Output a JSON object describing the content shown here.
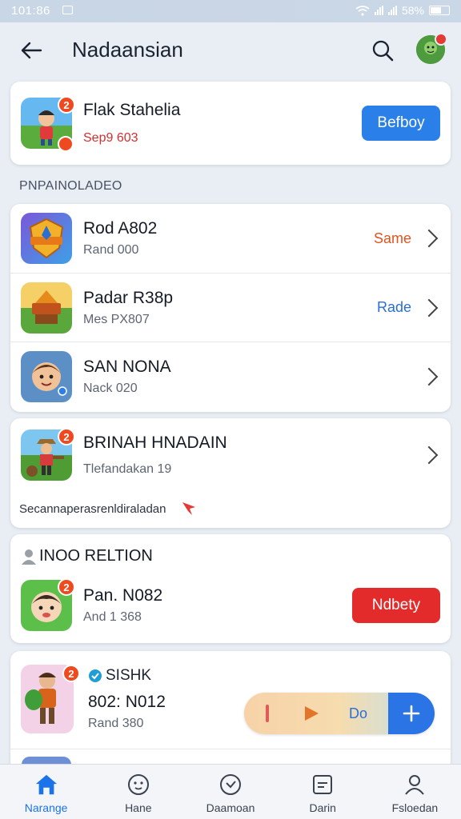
{
  "status_bar": {
    "time": "101:86",
    "battery_text": "58%"
  },
  "app_bar": {
    "title": "Nadaansian"
  },
  "featured": {
    "name": "Flak Stahelia",
    "sub": "Sep9 603",
    "badge": "2",
    "button_label": "Befboy",
    "button_color": "#2b7fe9"
  },
  "section_1": {
    "label": "PNPAINOLADEO"
  },
  "list": [
    {
      "name": "Rod A802",
      "sub": "Rand 000",
      "status": "Same",
      "status_color": "#e0531f"
    },
    {
      "name": "Padar R38p",
      "sub": "Mes PX807",
      "status": "Rade",
      "status_color": "#2a6fd6"
    },
    {
      "name": "SAN NONA",
      "sub": "Nack 020",
      "status": ""
    }
  ],
  "promo_card": {
    "name": "BRINAH HNADAIN",
    "sub": "Tlefandakan 19",
    "badge": "2",
    "note": "Secannaperasrenldiraladan"
  },
  "section_2": {
    "label": "INOO RELTION",
    "item": {
      "name": "Pan. N082",
      "sub": "And 1 368",
      "badge": "2",
      "button_label": "Ndbety",
      "button_color": "#e32b2b"
    }
  },
  "bottom_card": {
    "tag": "SISHK",
    "name": "802: N012",
    "sub": "Rand 380",
    "badge": "2",
    "player": {
      "label": "Do"
    }
  },
  "bottom_nav": [
    {
      "label": "Narange",
      "icon": "home-icon"
    },
    {
      "label": "Hane",
      "icon": "face-icon"
    },
    {
      "label": "Daamoan",
      "icon": "clock-icon"
    },
    {
      "label": "Darin",
      "icon": "gallery-icon"
    },
    {
      "label": "Fsloedan",
      "icon": "profile-icon"
    }
  ]
}
